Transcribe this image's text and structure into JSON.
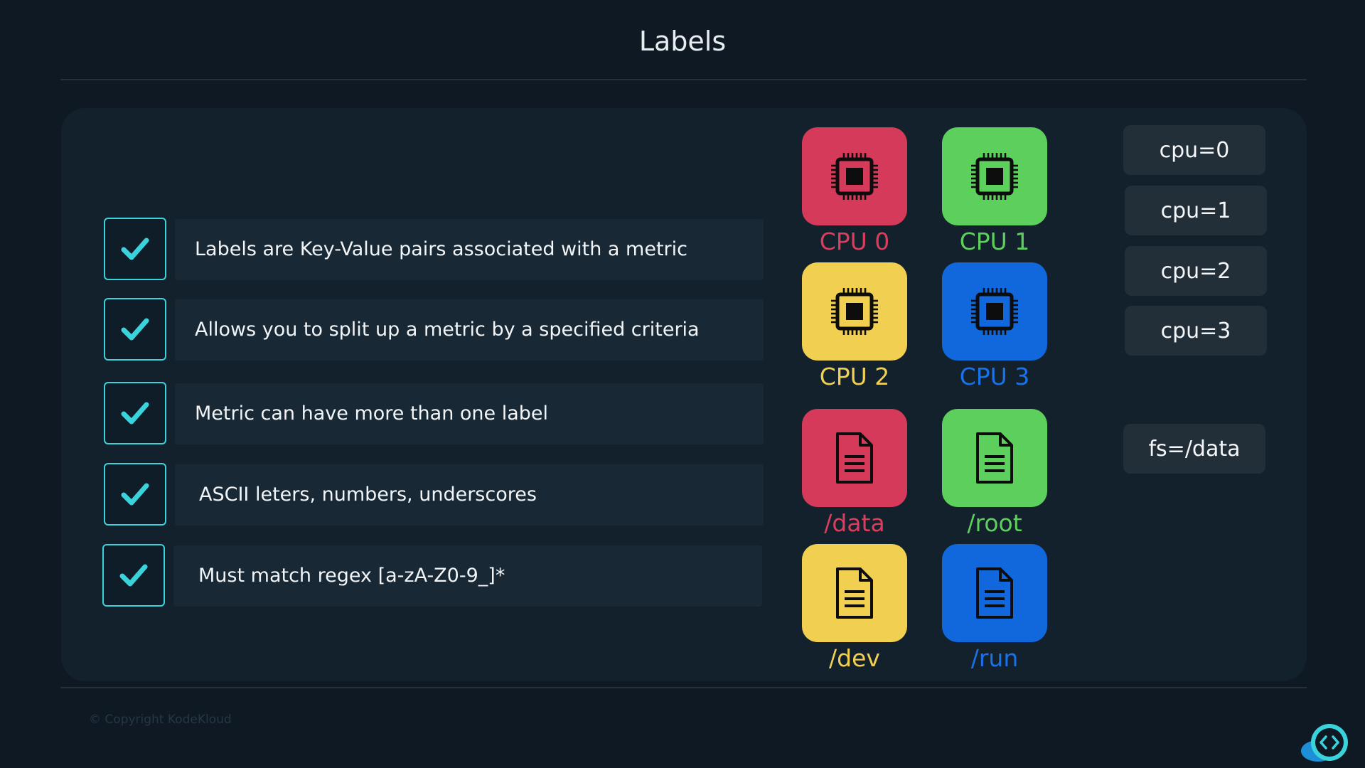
{
  "slide": {
    "title": "Labels",
    "copyright": "© Copyright KodeKloud"
  },
  "bullets": [
    {
      "text": "Labels are Key-Value pairs associated with a metric"
    },
    {
      "text": "Allows you to split up a metric by a specified criteria"
    },
    {
      "text": "Metric can have more than one label"
    },
    {
      "text": "ASCII leters, numbers, underscores"
    },
    {
      "text": "Must match regex [a-zA-Z0-9_]*"
    }
  ],
  "cpus": [
    {
      "label": "CPU 0",
      "color": "#d63a5a",
      "icon": "cpu-chip-icon"
    },
    {
      "label": "CPU 1",
      "color": "#5dcf5d",
      "icon": "cpu-chip-icon"
    },
    {
      "label": "CPU 2",
      "color": "#f1cf50",
      "icon": "cpu-chip-icon"
    },
    {
      "label": "CPU 3",
      "color": "#1168dc",
      "icon": "cpu-chip-icon"
    }
  ],
  "filesystems": [
    {
      "label": "/data",
      "color": "#d63a5a",
      "icon": "file-icon"
    },
    {
      "label": "/root",
      "color": "#5dcf5d",
      "icon": "file-icon"
    },
    {
      "label": "/dev",
      "color": "#f1cf50",
      "icon": "file-icon"
    },
    {
      "label": "/run",
      "color": "#1168dc",
      "icon": "file-icon"
    }
  ],
  "cpu_tags": [
    "cpu=0",
    "cpu=1",
    "cpu=2",
    "cpu=3"
  ],
  "fs_tag": "fs=/data",
  "accent": "#3ad3dc"
}
